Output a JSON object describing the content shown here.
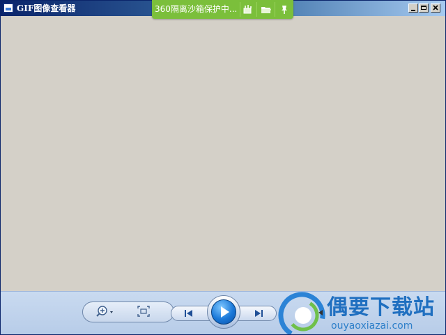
{
  "window": {
    "title": "GIF图像查看器",
    "controls": [
      "minimize",
      "maximize",
      "close"
    ]
  },
  "sandbox_banner": {
    "text": "360隔离沙箱保护中...",
    "icons": [
      "sandbox-tool-icon",
      "folder-icon",
      "pin-icon"
    ],
    "color": "#7bbf3b"
  },
  "toolbar": {
    "buttons": [
      "zoom-in",
      "fit-to-window",
      "previous",
      "play",
      "next"
    ]
  },
  "watermark": {
    "title": "偶要下载站",
    "url": "ouyaoxiazai.com"
  },
  "colors": {
    "title_bar": "#0a246a",
    "background": "#d4d0c8",
    "toolbar": "#c3d6ef",
    "play_button": "#1a78d8"
  }
}
